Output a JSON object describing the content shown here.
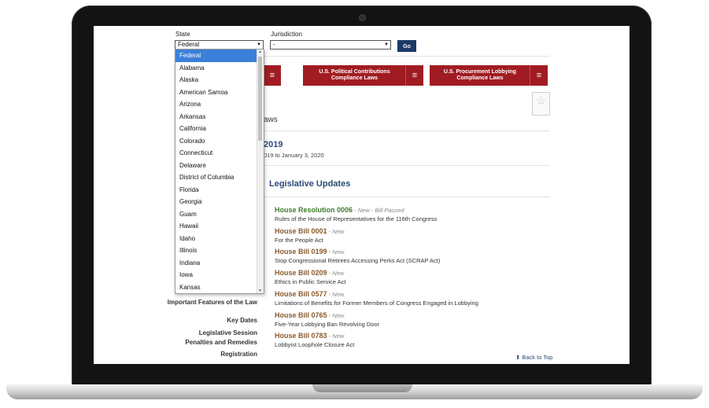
{
  "filters": {
    "state_label": "State",
    "state_value": "Federal",
    "jurisdiction_label": "Jurisdiction",
    "jurisdiction_value": "-",
    "go_label": "Go"
  },
  "state_options": [
    "Federal",
    "Alabama",
    "Alaska",
    "American Samoa",
    "Arizona",
    "Arkansas",
    "California",
    "Colorado",
    "Connecticut",
    "Delaware",
    "District of Columbia",
    "Florida",
    "Georgia",
    "Guam",
    "Hawaii",
    "Idaho",
    "Illinois",
    "Indiana",
    "Iowa",
    "Kansas"
  ],
  "nav_buttons": [
    {
      "label": ""
    },
    {
      "label": "U.S. Political Contributions Compliance Laws"
    },
    {
      "label": "U.S. Procurement Lobbying Compliance Laws"
    }
  ],
  "menu_glyph": "≡",
  "favorite_icon": "☆",
  "section": {
    "heading_partial": "aws",
    "session_year": "2019",
    "session_range": "019 to January 3, 2020",
    "updates_heading": "Legislative Updates"
  },
  "updates": [
    {
      "title": "House Resolution 0006",
      "tag": " - New - Bill Passed",
      "desc": "Rules of the House of Representatives for the 116th Congress",
      "color": "#3f7d2d"
    },
    {
      "title": "House Bill 0001",
      "tag": " - New",
      "desc": "For the People Act",
      "color": "#8a5a2c"
    },
    {
      "title": "House Bill 0199",
      "tag": " - New",
      "desc": "Stop Congressional Retirees Accessing Perks Act (SCRAP Act)",
      "color": "#8a5a2c"
    },
    {
      "title": "House Bill 0209",
      "tag": " - New",
      "desc": "Ethics in Public Service Act",
      "color": "#8a5a2c"
    },
    {
      "title": "House Bill 0577",
      "tag": " - New",
      "desc": "Limitations of Benefits for Former Members of Congress Engaged in Lobbying",
      "color": "#8a5a2c"
    },
    {
      "title": "House Bill 0765",
      "tag": " - New",
      "desc": "Five-Year Lobbying Ban Revolving Door",
      "color": "#8a5a2c"
    },
    {
      "title": "House Bill 0783",
      "tag": " - New",
      "desc": "Lobbyist Loophole Closure Act",
      "color": "#8a5a2c"
    }
  ],
  "sidebar": {
    "items": [
      "Important Features of the Law",
      "Key Dates",
      "Legislative Session",
      "Penalties and Remedies",
      "Registration"
    ]
  },
  "back_to_top": "⬆ Back to Top"
}
